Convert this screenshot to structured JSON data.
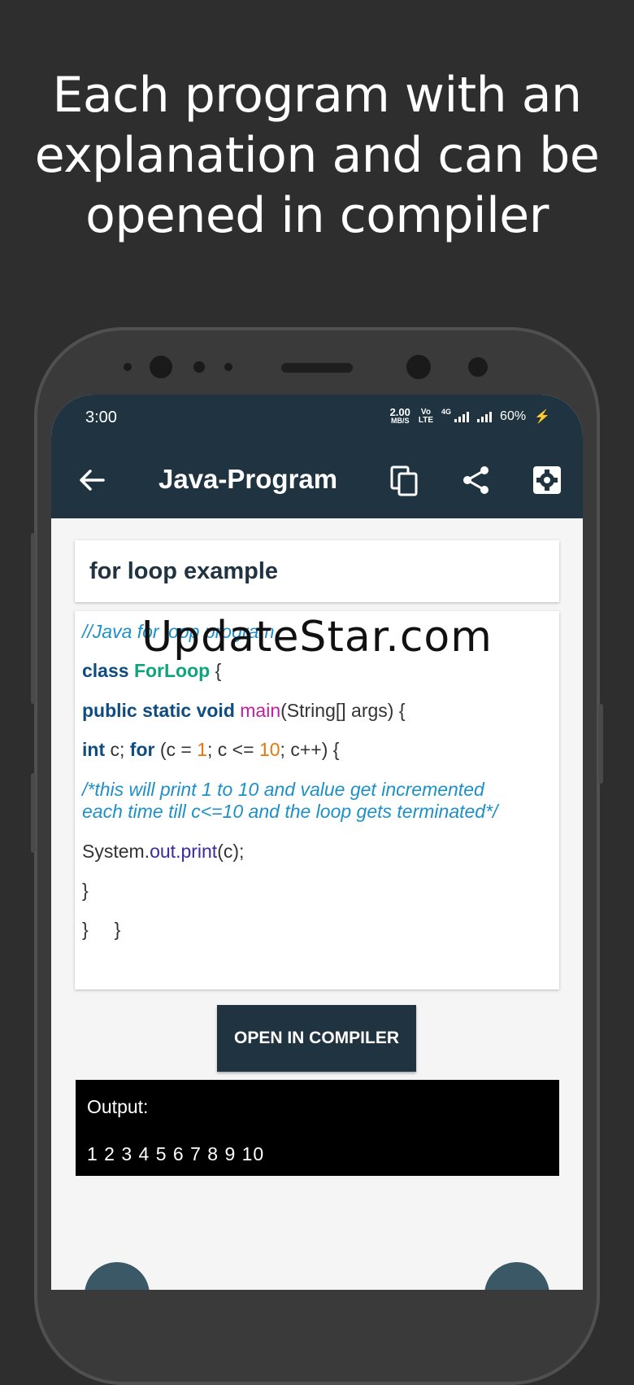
{
  "promo": {
    "line1": "Each program with an",
    "line2": "explanation and can be",
    "line3": "opened in compiler"
  },
  "status_bar": {
    "time": "3:00",
    "speed_value": "2.00",
    "speed_unit": "MB/S",
    "volte_top": "Vo",
    "volte_bottom": "LTE",
    "network": "4G",
    "battery": "60%"
  },
  "toolbar": {
    "title": "Java-Program",
    "back_icon": "arrow-back-icon",
    "copy_icon": "copy-icon",
    "share_icon": "share-icon",
    "settings_icon": "settings-icon"
  },
  "program": {
    "title": "for loop example",
    "code": {
      "comment1": "//Java for loop program",
      "class_kw": "class",
      "class_name": "ForLoop",
      "class_brace": " {",
      "main_kw": "public static void",
      "main_fn": "main",
      "main_rest": "(String[] args) {",
      "int_kw": "int",
      "var_c": " c; ",
      "for_kw": "for",
      "for_a": " (c = ",
      "num1": "1",
      "for_b": "; c <= ",
      "num10": "10",
      "for_c": "; c++) {",
      "comment2_line1": "/*this will print 1 to 10 and value get incremented",
      "comment2_line2": "each time till c<=10 and the loop gets terminated*/",
      "sys": "System.",
      "out": "out",
      "dot": ".",
      "print": "print",
      "print_args": "(c);",
      "close1": "}",
      "close2": "}     }"
    }
  },
  "watermark": "UpdateStar.com",
  "compile_button": "OPEN IN COMPILER",
  "output": {
    "label": "Output:",
    "result": "1 2 3 4 5 6 7 8 9 10"
  },
  "colors": {
    "primary": "#1f3440",
    "background": "#2e2e2e",
    "comment": "#1e90c8",
    "keyword": "#0f4c81",
    "class_name": "#10a37f",
    "method": "#c0209c",
    "number": "#e5770f"
  }
}
